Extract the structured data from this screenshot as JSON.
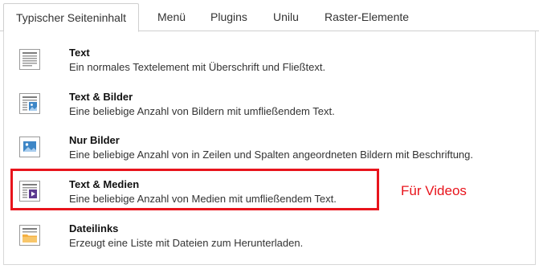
{
  "tabs": [
    {
      "label": "Typischer Seiteninhalt",
      "active": true
    },
    {
      "label": "Menü",
      "active": false
    },
    {
      "label": "Plugins",
      "active": false
    },
    {
      "label": "Unilu",
      "active": false
    },
    {
      "label": "Raster-Elemente",
      "active": false
    }
  ],
  "items": [
    {
      "title": "Text",
      "description": "Ein normales Textelement mit Überschrift und Fließtext.",
      "icon": "text-icon"
    },
    {
      "title": "Text & Bilder",
      "description": "Eine beliebige Anzahl von Bildern mit umfließendem Text.",
      "icon": "text-image-icon"
    },
    {
      "title": "Nur Bilder",
      "description": "Eine beliebige Anzahl von in Zeilen und Spalten angeordneten Bildern mit Beschriftung.",
      "icon": "image-icon"
    },
    {
      "title": "Text & Medien",
      "description": "Eine beliebige Anzahl von Medien mit umfließendem Text.",
      "icon": "text-media-icon"
    },
    {
      "title": "Dateilinks",
      "description": "Erzeugt eine Liste mit Dateien zum Herunterladen.",
      "icon": "file-links-icon"
    }
  ],
  "annotation": {
    "label": "Für Videos",
    "color": "#e8141c"
  }
}
